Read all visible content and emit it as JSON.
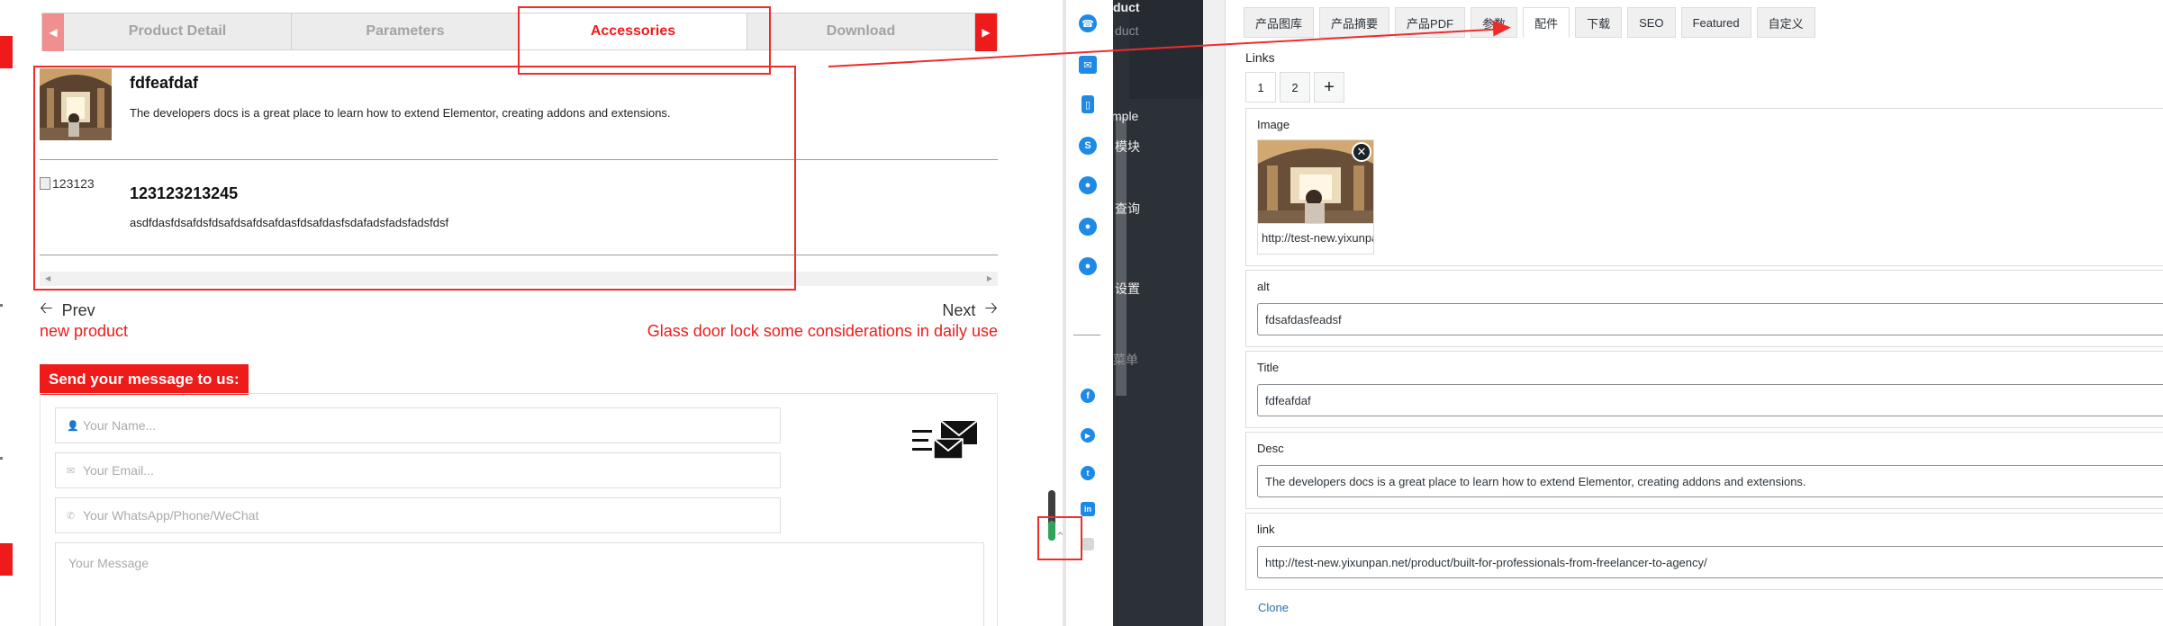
{
  "frontend": {
    "tabs": [
      {
        "label": "Product Detail"
      },
      {
        "label": "Parameters"
      },
      {
        "label": "Accessories"
      },
      {
        "label": "Download"
      }
    ],
    "accessories": [
      {
        "title": "fdfeafdaf",
        "desc": "The developers docs is a great place to learn how to extend Elementor, creating addons and extensions."
      },
      {
        "image_alt": "123123",
        "title": "123123213245",
        "desc": "asdfdasfdsafdsfdsafdsafdsafdasfdsafdasfsdafadsfadsfadsfdsf"
      }
    ],
    "pager": {
      "prev_label": "Prev",
      "prev_link": "new product",
      "next_label": "Next",
      "next_link": "Glass door lock some considerations in daily use"
    },
    "message": {
      "heading": "Send your message to us:",
      "name_placeholder": "Your Name...",
      "email_placeholder": "Your Email...",
      "phone_placeholder": "Your WhatsApp/Phone/WeChat",
      "message_placeholder": "Your Message"
    },
    "float_icons": [
      "whatsapp-icon",
      "email-icon",
      "phone-icon",
      "skype-icon",
      "qq-icon",
      "contact-icon",
      "wechat-icon",
      "facebook-icon",
      "youtube-icon",
      "twitter-icon",
      "linkedin-icon"
    ]
  },
  "admin": {
    "menu": [
      {
        "label": "duct"
      },
      {
        "label": "duct"
      },
      {
        "label": "mple"
      },
      {
        "label": "模块"
      },
      {
        "label": "查询"
      },
      {
        "label": "设置"
      },
      {
        "label": "菜单"
      }
    ],
    "tabs": [
      {
        "label": "产品图库"
      },
      {
        "label": "产品摘要"
      },
      {
        "label": "产品PDF"
      },
      {
        "label": "参数"
      },
      {
        "label": "配件"
      },
      {
        "label": "下载"
      },
      {
        "label": "SEO"
      },
      {
        "label": "Featured"
      },
      {
        "label": "自定义"
      }
    ],
    "links_label": "Links",
    "link_tabs": [
      "1",
      "2",
      "+"
    ],
    "image": {
      "label": "Image",
      "url": "http://test-new.yixunpan.net"
    },
    "alt": {
      "label": "alt",
      "value": "fdsafdasfeadsf"
    },
    "title": {
      "label": "Title",
      "value": "fdfeafdaf"
    },
    "desc": {
      "label": "Desc",
      "value": "The developers docs is a great place to learn how to extend Elementor, creating addons and extensions."
    },
    "link": {
      "label": "link",
      "value": "http://test-new.yixunpan.net/product/built-for-professionals-from-freelancer-to-agency/"
    },
    "clone_label": "Clone"
  },
  "colors": {
    "accent": "#ef1b1b",
    "annotation": "#ef2b2b",
    "admin_sidebar": "#1e232a",
    "link_blue": "#2271b1"
  }
}
